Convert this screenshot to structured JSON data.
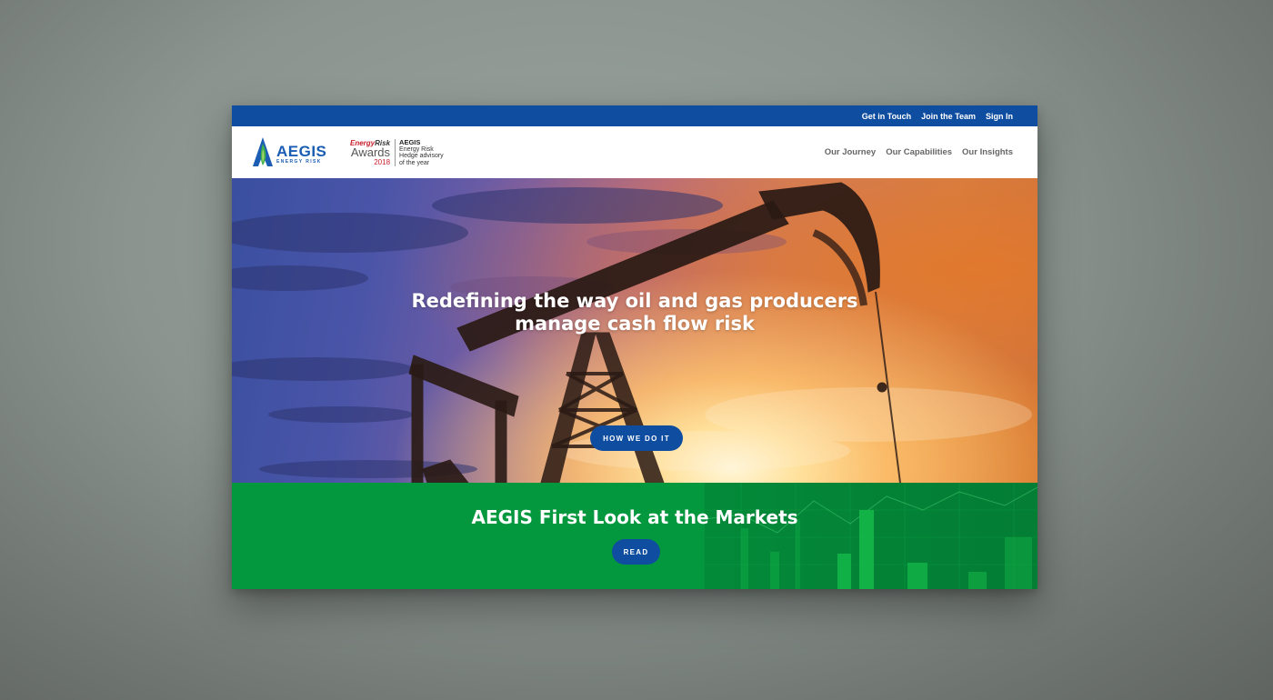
{
  "topbar": {
    "links": [
      "Get in Touch",
      "Join the Team",
      "Sign In"
    ]
  },
  "logo": {
    "name": "AEGIS",
    "subtitle": "ENERGY RISK",
    "icon": "aegis-flame-icon"
  },
  "award": {
    "brand_part1": "Energy",
    "brand_part2": "Risk",
    "awards": "Awards",
    "year": "2018",
    "line1": "AEGIS",
    "line2": "Energy Risk",
    "line3": "Hedge advisory",
    "line4": "of the year"
  },
  "nav": {
    "items": [
      "Our Journey",
      "Our Capabilities",
      "Our Insights"
    ]
  },
  "hero": {
    "title_line1": "Redefining the way oil and gas producers",
    "title_line2": "manage cash flow risk",
    "button": "HOW WE DO IT",
    "image": "oil-pumpjack-sunset-image"
  },
  "markets": {
    "title": "AEGIS First Look at the Markets",
    "button": "READ",
    "image": "stock-chart-background-image"
  },
  "colors": {
    "topbar": "#0f4da0",
    "button": "#0f4da0",
    "markets_bg": "#03983e",
    "nav_text": "#666666"
  }
}
